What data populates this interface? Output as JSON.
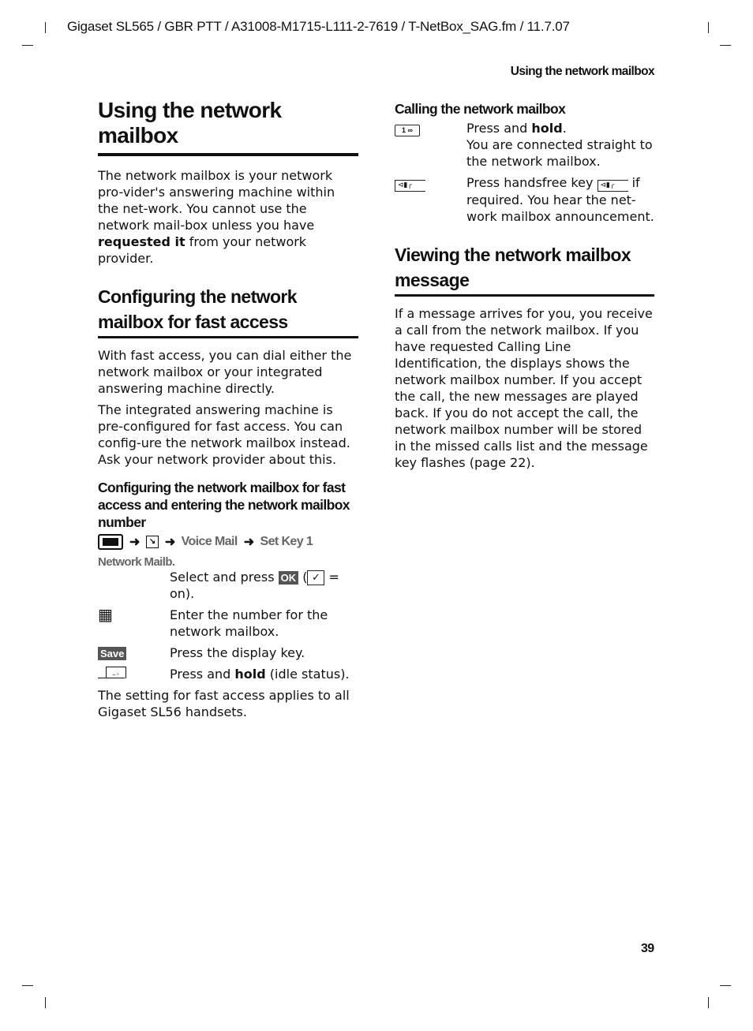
{
  "header": {
    "running_head": "Gigaset SL565 / GBR PTT / A31008-M1715-L111-2-7619 / T-NetBox_SAG.fm / 11.7.07",
    "section_title": "Using the network mailbox"
  },
  "left": {
    "title": "Using the network mailbox",
    "intro_pre": "The network mailbox is your network pro-vider's answering machine within the net-work. You cannot use the network mail-box unless you have ",
    "intro_bold": "requested it",
    "intro_post": " from your network provider.",
    "config_heading": "Configuring the network mailbox for fast access",
    "config_p1": "With fast access, you can dial either the network mailbox or your integrated answering machine directly.",
    "config_p2": "The integrated answering machine is pre-configured for fast access. You can config-ure the network mailbox instead. Ask your network provider about this.",
    "sub_heading": "Configuring the network mailbox for fast access and entering the network mailbox number",
    "nav": {
      "icon1": "menu-key-icon",
      "arrow": "➜",
      "icon2": "settings-icon",
      "item1": "Voice Mail",
      "item2": "Set Key 1"
    },
    "option_label": "Network Mailb.",
    "steps": [
      {
        "icon": "",
        "pre": "Select and press ",
        "ok": "OK",
        "check_open": " (",
        "check": "✓",
        "post": " = on)."
      },
      {
        "icon": "keypad-icon",
        "text": "Enter the number for the network mailbox."
      },
      {
        "icon": "Save",
        "text": "Press the display key."
      },
      {
        "icon": "end-call-key-icon",
        "pre": "Press and ",
        "bold": "hold",
        "post": " (idle status)."
      }
    ],
    "footer_note": "The setting for fast access applies to all Gigaset SL56 handsets."
  },
  "right": {
    "calling_heading": "Calling the network mailbox",
    "calling_steps": [
      {
        "icon": "1 ∞",
        "pre": "Press and ",
        "bold": "hold",
        "post": ".",
        "line2": "You are connected straight to the network mailbox."
      },
      {
        "icon": "handsfree-key-icon",
        "pre": "Press handsfree key ",
        "post": " if required. You hear the net-work mailbox announcement."
      }
    ],
    "viewing_heading": "Viewing the network mailbox message",
    "viewing_text": "If a message arrives for you, you receive a call from the network mailbox. If you have requested Calling Line Identification, the displays shows the network mailbox number. If you accept the call, the new messages are played back. If you do not accept the call, the network mailbox number will be stored in the missed calls list and the message key flashes (page 22)."
  },
  "footer": {
    "page_number": "39"
  }
}
